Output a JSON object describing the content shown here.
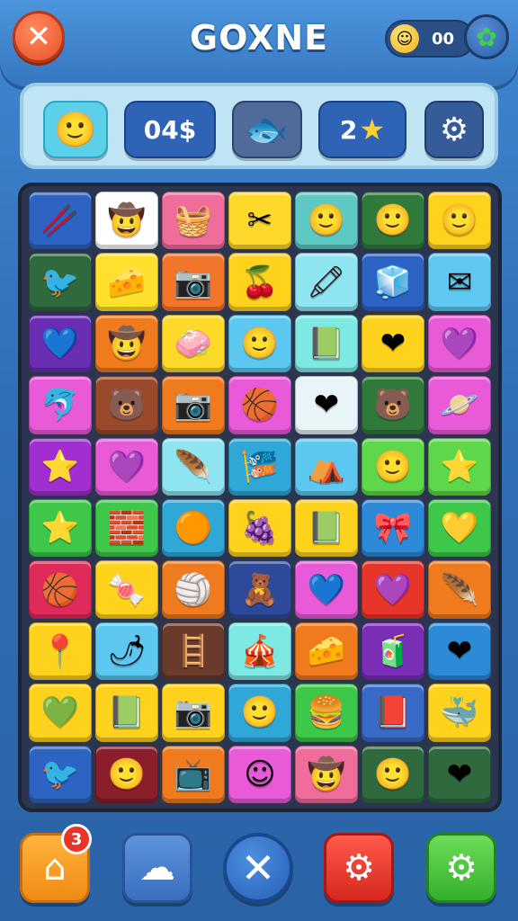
{
  "header": {
    "title": "GOXNE",
    "close_icon": "✕",
    "coin_icon": "☺",
    "coin_value": "00",
    "gem_icon": "✿"
  },
  "stats": {
    "smile_icon": "🙂",
    "score": "04$",
    "fish_icon": "🐟",
    "stars_value": "2",
    "star_icon": "★",
    "gear_icon": "⚙"
  },
  "board": {
    "rows": 10,
    "cols": 7,
    "tiles": [
      {
        "icon": "🥢",
        "color": "#2d63c2"
      },
      {
        "icon": "🤠",
        "color": "#ffffff"
      },
      {
        "icon": "🧺",
        "color": "#f06c9a"
      },
      {
        "icon": "✂",
        "color": "#ffd92a"
      },
      {
        "icon": "🙂",
        "color": "#5ec8c2"
      },
      {
        "icon": "🙂",
        "color": "#2f7a3a"
      },
      {
        "icon": "🙂",
        "color": "#ffd21e"
      },
      {
        "icon": "🐦",
        "color": "#2f6a3e"
      },
      {
        "icon": "🧀",
        "color": "#ffe02c"
      },
      {
        "icon": "📷",
        "color": "#f2762a"
      },
      {
        "icon": "🍒",
        "color": "#ffd21e"
      },
      {
        "icon": "🖍",
        "color": "#8fe4f2"
      },
      {
        "icon": "🧊",
        "color": "#2d63c2"
      },
      {
        "icon": "✉",
        "color": "#5ec8f0"
      },
      {
        "icon": "💙",
        "color": "#6a2eb5"
      },
      {
        "icon": "🤠",
        "color": "#f07a1e"
      },
      {
        "icon": "🧼",
        "color": "#ffd92a"
      },
      {
        "icon": "🙂",
        "color": "#5cc8f0"
      },
      {
        "icon": "📗",
        "color": "#7ee8e2"
      },
      {
        "icon": "❤",
        "color": "#ffd21e"
      },
      {
        "icon": "💜",
        "color": "#e85ad8"
      },
      {
        "icon": "🐬",
        "color": "#e85ad8"
      },
      {
        "icon": "🐻",
        "color": "#9a4a2a"
      },
      {
        "icon": "📷",
        "color": "#f07a1e"
      },
      {
        "icon": "🏀",
        "color": "#e85ad8"
      },
      {
        "icon": "❤",
        "color": "#e8f4f8"
      },
      {
        "icon": "🐻",
        "color": "#2f7a3a"
      },
      {
        "icon": "🪐",
        "color": "#e85ad8"
      },
      {
        "icon": "⭐",
        "color": "#a02ed0"
      },
      {
        "icon": "💜",
        "color": "#e85ad8"
      },
      {
        "icon": "🪶",
        "color": "#8fe4f2"
      },
      {
        "icon": "🎏",
        "color": "#2fa8d8"
      },
      {
        "icon": "⛺",
        "color": "#5cc8f0"
      },
      {
        "icon": "🙂",
        "color": "#5ed84a"
      },
      {
        "icon": "⭐",
        "color": "#5ed84a"
      },
      {
        "icon": "⭐",
        "color": "#3ec84a"
      },
      {
        "icon": "🧱",
        "color": "#3ec84a"
      },
      {
        "icon": "🟠",
        "color": "#2fa8d8"
      },
      {
        "icon": "🍇",
        "color": "#ffd21e"
      },
      {
        "icon": "📗",
        "color": "#ffd21e"
      },
      {
        "icon": "🎀",
        "color": "#2d8ad8"
      },
      {
        "icon": "💛",
        "color": "#3ec84a"
      },
      {
        "icon": "🏀",
        "color": "#e02a5a"
      },
      {
        "icon": "🍬",
        "color": "#ffd21e"
      },
      {
        "icon": "🏐",
        "color": "#f07a1e"
      },
      {
        "icon": "🧸",
        "color": "#2d4a9a"
      },
      {
        "icon": "💙",
        "color": "#e85ad8"
      },
      {
        "icon": "💜",
        "color": "#e8352a"
      },
      {
        "icon": "🪶",
        "color": "#f07a1e"
      },
      {
        "icon": "📍",
        "color": "#ffd21e"
      },
      {
        "icon": "🌶",
        "color": "#5cc8f0"
      },
      {
        "icon": "🪜",
        "color": "#6a3a2a"
      },
      {
        "icon": "🎪",
        "color": "#7ee8e2"
      },
      {
        "icon": "🧀",
        "color": "#f07a1e"
      },
      {
        "icon": "🧃",
        "color": "#7a2eb5"
      },
      {
        "icon": "❤",
        "color": "#2d8ad8"
      },
      {
        "icon": "💚",
        "color": "#ffd21e"
      },
      {
        "icon": "📗",
        "color": "#ffd21e"
      },
      {
        "icon": "📷",
        "color": "#ffd21e"
      },
      {
        "icon": "🙂",
        "color": "#2fa8d8"
      },
      {
        "icon": "🍔",
        "color": "#3ec84a"
      },
      {
        "icon": "📕",
        "color": "#3a6ac8"
      },
      {
        "icon": "🐳",
        "color": "#ffd21e"
      },
      {
        "icon": "🐦",
        "color": "#2d63c2"
      },
      {
        "icon": "🙂",
        "color": "#8a1e2a"
      },
      {
        "icon": "📺",
        "color": "#f07a1e"
      },
      {
        "icon": "☺",
        "color": "#e85ad8"
      },
      {
        "icon": "🤠",
        "color": "#f06c9a"
      },
      {
        "icon": "🙂",
        "color": "#2f6a3e"
      },
      {
        "icon": "❤",
        "color": "#2f6a3e"
      }
    ]
  },
  "nav": {
    "home_icon": "⌂",
    "badge_text": "3",
    "cloud_icon": "☁",
    "close_icon": "✕",
    "gear_red_icon": "⚙",
    "gear_green_icon": "⚙"
  }
}
